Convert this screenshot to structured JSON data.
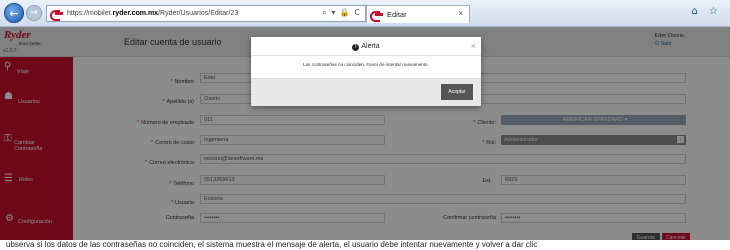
{
  "browser": {
    "url_prefix": "https://mobilet.",
    "url_host": "ryder.com.mx",
    "url_path": "/Ryder/Usuarios/Editar/23",
    "address_icons": "⌕ ▾ 🔒 C",
    "tab_title": "Editar",
    "tab_close": "×",
    "right_icons": "⌂ ☆"
  },
  "header": {
    "brand": "Ryder",
    "brand_tagline": "Ever better.",
    "version": "v1.5.7",
    "title": "Editar cuenta de usuario",
    "user_name": "Eder Osorio",
    "logout": "Salir"
  },
  "sidebar": {
    "items": [
      {
        "icon": "⚲",
        "label": "Viaje"
      },
      {
        "icon": "☗",
        "label": "Usuarios"
      },
      {
        "icon": "⚿",
        "label": "Cambiar Contraseña"
      },
      {
        "icon": "☰",
        "label": "Roles"
      },
      {
        "icon": "⚙",
        "label": "Configuración"
      }
    ]
  },
  "form": {
    "nombre_label": "Nombre",
    "nombre_value": "Eder",
    "apellido_label": "Apellido (s)",
    "apellido_value": "Osorio",
    "empleado_label": "Número de empleado",
    "empleado_value": "011",
    "cliente_label": "Cliente:",
    "cliente_value": "AMERICAN STANDARD ▾",
    "centro_label": "Centro de costo",
    "centro_value": "Ingeniería",
    "rol_label": "Rol:",
    "rol_value": "Administrador",
    "correo_label": "Correo electrónico",
    "correo_value": "eosorio@desoftware.mx",
    "telefono_label": "Teléfono",
    "telefono_value": "5513269613",
    "ext_label": "Ext.",
    "ext_value": "6923",
    "usuario_label": "Usuario",
    "usuario_value": "Eosorio",
    "contrasena_label": "Contraseña",
    "contrasena_value": "••••••••",
    "confirmar_label": "Confirmar contraseña",
    "confirmar_value": "••••••••",
    "required_mark": "*"
  },
  "buttons": {
    "save": "Guardar",
    "cancel": "Cancelar"
  },
  "modal": {
    "icon": "!",
    "title": "Alerta",
    "close": "×",
    "message": "Las contraseñas no coinciden. Favor de intentar nuevamente.",
    "accept": "Aceptar"
  },
  "bottom_text": "ubserva si los datos de las contraseñas no coinciden, el sistema muestra el mensaje de alerta, el usuario debe intentar nuevamente y volver a dar clic"
}
